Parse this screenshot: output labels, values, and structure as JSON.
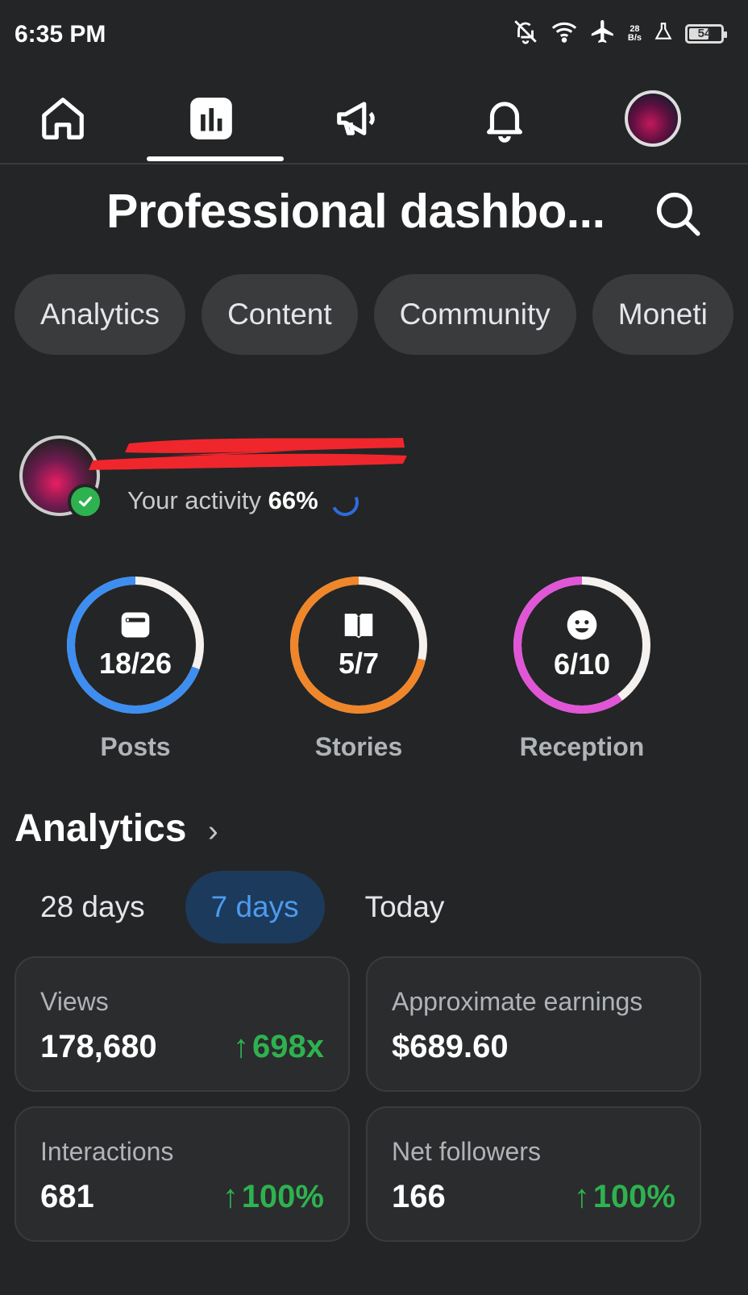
{
  "status_bar": {
    "time": "6:35 PM",
    "network_speed_top": "28",
    "network_speed_bottom": "B/s",
    "battery": "54",
    "icons": [
      "notifications-off-icon",
      "wifi-icon",
      "airplane-icon",
      "network-speed",
      "lab-icon",
      "battery-icon"
    ]
  },
  "top_nav": {
    "items": [
      "home-icon",
      "insights-icon",
      "megaphone-icon",
      "bell-icon",
      "profile-avatar"
    ],
    "active_index": 1
  },
  "header": {
    "title": "Professional dashbo..."
  },
  "chips": [
    "Analytics",
    "Content",
    "Community",
    "Moneti"
  ],
  "profile": {
    "activity_label": "Your activity",
    "activity_value": "66%"
  },
  "rings": [
    {
      "value": "18/26",
      "label": "Posts",
      "progress": 0.6923,
      "color": "#3d8ef0",
      "icon": "post-icon"
    },
    {
      "value": "5/7",
      "label": "Stories",
      "progress": 0.7143,
      "color": "#f0862a",
      "icon": "book-icon"
    },
    {
      "value": "6/10",
      "label": "Reception",
      "progress": 0.6,
      "color": "#e056d6",
      "icon": "smile-icon"
    }
  ],
  "analytics": {
    "title": "Analytics",
    "ranges": [
      "28 days",
      "7 days",
      "Today"
    ],
    "active_range": 1,
    "cards": [
      {
        "label": "Views",
        "value": "178,680",
        "change": "698x"
      },
      {
        "label": "Approximate earnings",
        "value": "$689.60",
        "change": ""
      },
      {
        "label": "Interactions",
        "value": "681",
        "change": "100%"
      },
      {
        "label": "Net followers",
        "value": "166",
        "change": "100%"
      }
    ]
  },
  "colors": {
    "background": "#242526",
    "chip": "#3a3b3c",
    "positive": "#2eb24f",
    "active_range_bg": "#1c3a5b",
    "active_range_text": "#4d9bf0"
  }
}
